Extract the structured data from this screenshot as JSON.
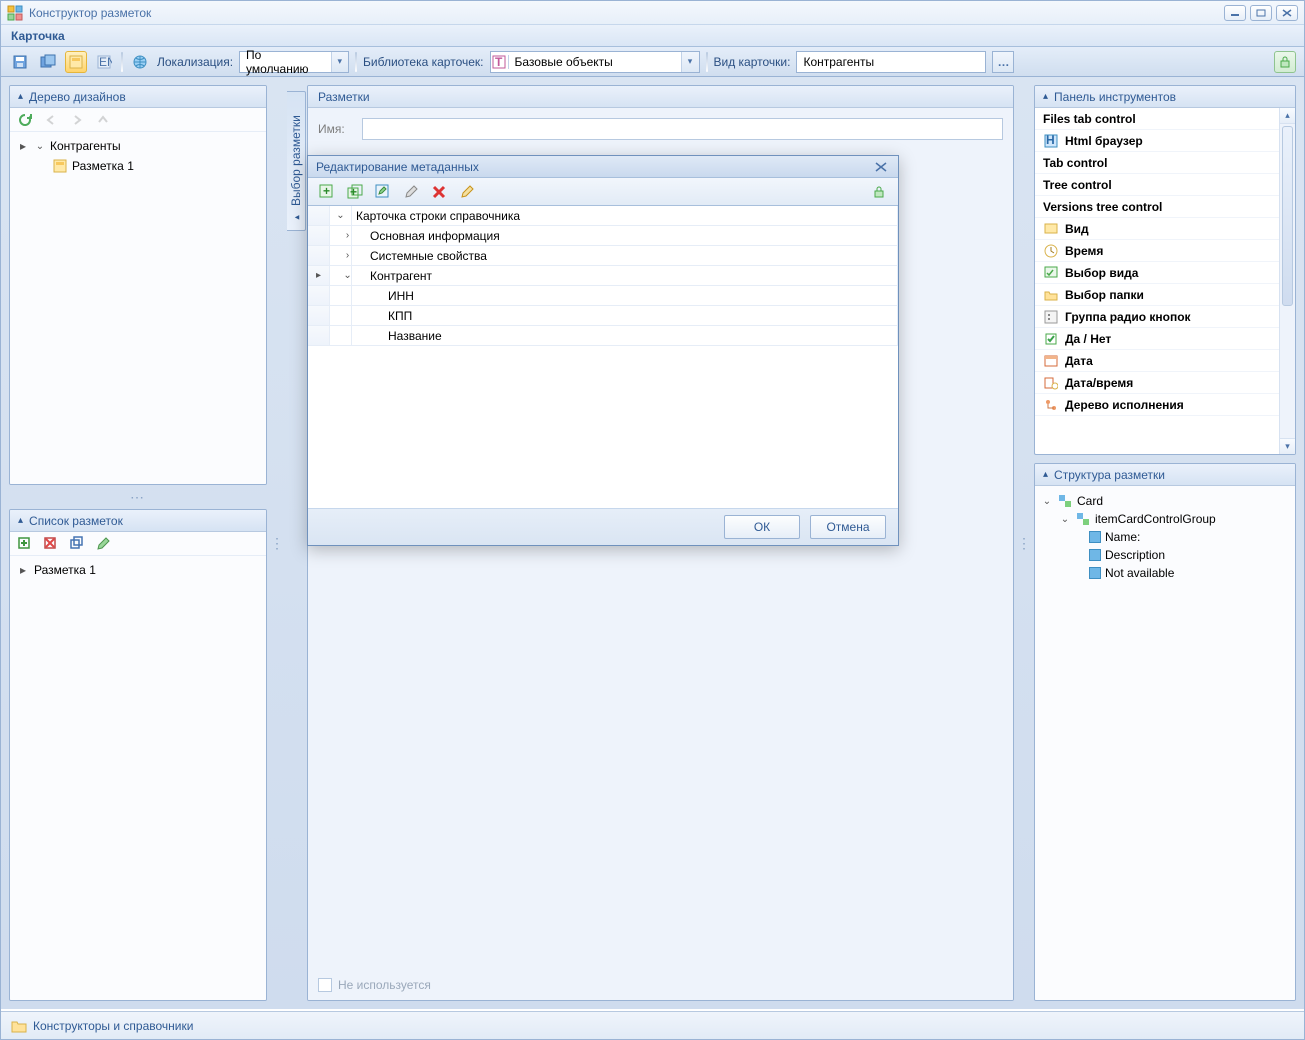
{
  "window": {
    "title": "Конструктор разметок"
  },
  "menu": {
    "card": "Карточка"
  },
  "toolbar": {
    "localization_label": "Локализация:",
    "localization_value": "По умолчанию",
    "library_label": "Библиотека карточек:",
    "library_value": "Базовые объекты",
    "cardtype_label": "Вид карточки:",
    "cardtype_value": "Контрагенты"
  },
  "left": {
    "designs_title": "Дерево дизайнов",
    "root": "Контрагенты",
    "child": "Разметка 1",
    "layouts_title": "Список разметок",
    "layout_item": "Разметка 1"
  },
  "center": {
    "header": "Разметки",
    "name_label": "Имя:",
    "not_used": "Не используется",
    "side_tab": "Выбор разметки"
  },
  "dialog": {
    "title": "Редактирование метаданных",
    "rows": {
      "r0": "Карточка строки справочника",
      "r1": "Основная информация",
      "r2": "Системные свойства",
      "r3": "Контрагент",
      "r4": "ИНН",
      "r5": "КПП",
      "r6": "Название"
    },
    "ok": "ОК",
    "cancel": "Отмена"
  },
  "right": {
    "toolbox_title": "Панель инструментов",
    "items": {
      "i0": "Files tab control",
      "i1": "Html браузер",
      "i2": "Tab control",
      "i3": "Tree control",
      "i4": "Versions tree control",
      "i5": "Вид",
      "i6": "Время",
      "i7": "Выбор вида",
      "i8": "Выбор папки",
      "i9": "Группа радио кнопок",
      "i10": "Да / Нет",
      "i11": "Дата",
      "i12": "Дата/время",
      "i13": "Дерево исполнения"
    },
    "structure_title": "Структура разметки",
    "structure": {
      "card": "Card",
      "group": "itemCardControlGroup",
      "n0": "Name:",
      "n1": "Description",
      "n2": "Not available"
    }
  },
  "status": {
    "label": "Конструкторы и справочники"
  }
}
